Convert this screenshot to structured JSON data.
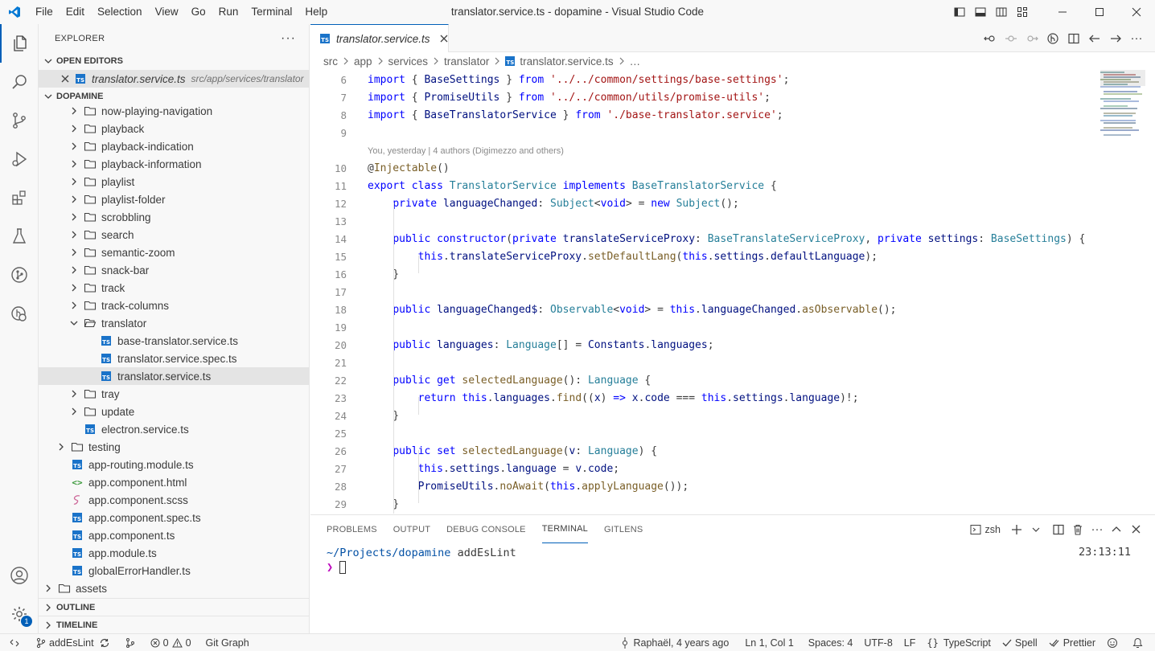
{
  "window": {
    "title": "translator.service.ts - dopamine - Visual Studio Code",
    "menu": [
      "File",
      "Edit",
      "Selection",
      "View",
      "Go",
      "Run",
      "Terminal",
      "Help"
    ]
  },
  "sidebar": {
    "header": "EXPLORER",
    "open_editors_label": "OPEN EDITORS",
    "open_editor": {
      "name": "translator.service.ts",
      "path": "src/app/services/translator"
    },
    "project_label": "DOPAMINE",
    "tree": [
      {
        "label": "now-playing-navigation",
        "type": "folder",
        "depth": 4,
        "open": false
      },
      {
        "label": "playback",
        "type": "folder",
        "depth": 4,
        "open": false
      },
      {
        "label": "playback-indication",
        "type": "folder",
        "depth": 4,
        "open": false
      },
      {
        "label": "playback-information",
        "type": "folder",
        "depth": 4,
        "open": false
      },
      {
        "label": "playlist",
        "type": "folder",
        "depth": 4,
        "open": false
      },
      {
        "label": "playlist-folder",
        "type": "folder",
        "depth": 4,
        "open": false
      },
      {
        "label": "scrobbling",
        "type": "folder",
        "depth": 4,
        "open": false
      },
      {
        "label": "search",
        "type": "folder",
        "depth": 4,
        "open": false
      },
      {
        "label": "semantic-zoom",
        "type": "folder",
        "depth": 4,
        "open": false
      },
      {
        "label": "snack-bar",
        "type": "folder",
        "depth": 4,
        "open": false
      },
      {
        "label": "track",
        "type": "folder",
        "depth": 4,
        "open": false
      },
      {
        "label": "track-columns",
        "type": "folder",
        "depth": 4,
        "open": false
      },
      {
        "label": "translator",
        "type": "folder",
        "depth": 4,
        "open": true
      },
      {
        "label": "base-translator.service.ts",
        "type": "ts",
        "depth": 5
      },
      {
        "label": "translator.service.spec.ts",
        "type": "ts",
        "depth": 5
      },
      {
        "label": "translator.service.ts",
        "type": "ts",
        "depth": 5,
        "selected": true
      },
      {
        "label": "tray",
        "type": "folder",
        "depth": 4,
        "open": false
      },
      {
        "label": "update",
        "type": "folder",
        "depth": 4,
        "open": false
      },
      {
        "label": "electron.service.ts",
        "type": "ts",
        "depth": 4
      },
      {
        "label": "testing",
        "type": "folder",
        "depth": 3,
        "open": false
      },
      {
        "label": "app-routing.module.ts",
        "type": "ts",
        "depth": 3
      },
      {
        "label": "app.component.html",
        "type": "html",
        "depth": 3
      },
      {
        "label": "app.component.scss",
        "type": "scss",
        "depth": 3
      },
      {
        "label": "app.component.spec.ts",
        "type": "ts",
        "depth": 3
      },
      {
        "label": "app.component.ts",
        "type": "ts",
        "depth": 3
      },
      {
        "label": "app.module.ts",
        "type": "ts",
        "depth": 3
      },
      {
        "label": "globalErrorHandler.ts",
        "type": "ts",
        "depth": 3
      },
      {
        "label": "assets",
        "type": "folder",
        "depth": 2,
        "open": false
      }
    ],
    "outline_label": "OUTLINE",
    "timeline_label": "TIMELINE"
  },
  "editor": {
    "tab": "translator.service.ts",
    "breadcrumb": [
      "src",
      "app",
      "services",
      "translator",
      "translator.service.ts",
      "…"
    ],
    "blame": "You, yesterday | 4 authors (Digimezzo and others)",
    "lines": [
      {
        "n": "6",
        "html": "<span class=\"kw\">import</span> { <span class=\"pr\">BaseSettings</span> } <span class=\"kw\">from</span> <span class=\"str\">'../../common/settings/base-settings'</span>;"
      },
      {
        "n": "7",
        "html": "<span class=\"kw\">import</span> { <span class=\"pr\">PromiseUtils</span> } <span class=\"kw\">from</span> <span class=\"str\">'../../common/utils/promise-utils'</span>;"
      },
      {
        "n": "8",
        "html": "<span class=\"kw\">import</span> { <span class=\"pr\">BaseTranslatorService</span> } <span class=\"kw\">from</span> <span class=\"str\">'./base-translator.service'</span>;"
      },
      {
        "n": "9",
        "html": ""
      },
      {
        "n": "",
        "blame": true
      },
      {
        "n": "10",
        "html": "@<span class=\"dec\">Injectable</span>()"
      },
      {
        "n": "11",
        "html": "<span class=\"kw\">export</span> <span class=\"kw\">class</span> <span class=\"ty\">TranslatorService</span> <span class=\"kw\">implements</span> <span class=\"ty\">BaseTranslatorService</span> {"
      },
      {
        "n": "12",
        "html": "    <span class=\"kw\">private</span> <span class=\"pr\">languageChanged</span>: <span class=\"ty\">Subject</span>&lt;<span class=\"kw\">void</span>&gt; = <span class=\"kw\">new</span> <span class=\"ty\">Subject</span>();"
      },
      {
        "n": "13",
        "html": ""
      },
      {
        "n": "14",
        "html": "    <span class=\"kw\">public</span> <span class=\"kw\">constructor</span>(<span class=\"kw\">private</span> <span class=\"pr\">translateServiceProxy</span>: <span class=\"ty\">BaseTranslateServiceProxy</span>, <span class=\"kw\">private</span> <span class=\"pr\">settings</span>: <span class=\"ty\">BaseSettings</span>) {"
      },
      {
        "n": "15",
        "html": "        <span class=\"kw\">this</span>.<span class=\"pr\">translateServiceProxy</span>.<span class=\"fn\">setDefaultLang</span>(<span class=\"kw\">this</span>.<span class=\"pr\">settings</span>.<span class=\"pr\">defaultLanguage</span>);"
      },
      {
        "n": "16",
        "html": "    }"
      },
      {
        "n": "17",
        "html": ""
      },
      {
        "n": "18",
        "html": "    <span class=\"kw\">public</span> <span class=\"pr\">languageChanged$</span>: <span class=\"ty\">Observable</span>&lt;<span class=\"kw\">void</span>&gt; = <span class=\"kw\">this</span>.<span class=\"pr\">languageChanged</span>.<span class=\"fn\">asObservable</span>();"
      },
      {
        "n": "19",
        "html": ""
      },
      {
        "n": "20",
        "html": "    <span class=\"kw\">public</span> <span class=\"pr\">languages</span>: <span class=\"ty\">Language</span>[] = <span class=\"pr\">Constants</span>.<span class=\"pr\">languages</span>;"
      },
      {
        "n": "21",
        "html": ""
      },
      {
        "n": "22",
        "html": "    <span class=\"kw\">public</span> <span class=\"kw\">get</span> <span class=\"fn\">selectedLanguage</span>(): <span class=\"ty\">Language</span> {"
      },
      {
        "n": "23",
        "html": "        <span class=\"kw\">return</span> <span class=\"kw\">this</span>.<span class=\"pr\">languages</span>.<span class=\"fn\">find</span>((<span class=\"pr\">x</span>) <span class=\"kw\">=&gt;</span> <span class=\"pr\">x</span>.<span class=\"pr\">code</span> === <span class=\"kw\">this</span>.<span class=\"pr\">settings</span>.<span class=\"pr\">language</span>)!;"
      },
      {
        "n": "24",
        "html": "    }"
      },
      {
        "n": "25",
        "html": ""
      },
      {
        "n": "26",
        "html": "    <span class=\"kw\">public</span> <span class=\"kw\">set</span> <span class=\"fn\">selectedLanguage</span>(<span class=\"pr\">v</span>: <span class=\"ty\">Language</span>) {"
      },
      {
        "n": "27",
        "html": "        <span class=\"kw\">this</span>.<span class=\"pr\">settings</span>.<span class=\"pr\">language</span> = <span class=\"pr\">v</span>.<span class=\"pr\">code</span>;"
      },
      {
        "n": "28",
        "html": "        <span class=\"pr\">PromiseUtils</span>.<span class=\"fn\">noAwait</span>(<span class=\"kw\">this</span>.<span class=\"fn\">applyLanguage</span>());"
      },
      {
        "n": "29",
        "html": "    }"
      }
    ]
  },
  "panel": {
    "tabs": [
      "PROBLEMS",
      "OUTPUT",
      "DEBUG CONSOLE",
      "TERMINAL",
      "GITLENS"
    ],
    "active_tab": "TERMINAL",
    "shell": "zsh",
    "terminal": {
      "path": "~/Projects/dopamine",
      "branch": "addEsLint",
      "time": "23:13:11",
      "prompt": "❯"
    }
  },
  "statusbar": {
    "branch": "addEsLint",
    "errors": "0",
    "warnings": "0",
    "git_graph": "Git Graph",
    "blame": "Raphaël, 4 years ago",
    "position": "Ln 1, Col 1",
    "spaces": "Spaces: 4",
    "encoding": "UTF-8",
    "eol": "LF",
    "language": "TypeScript",
    "spell": "Spell",
    "prettier": "Prettier"
  },
  "accounts_badge": "1",
  "colors": {
    "accent": "#005fb8",
    "ts_icon": "#1a73c9",
    "keyword": "#0000ff",
    "type": "#267f99",
    "string": "#a31515",
    "function": "#795e26"
  }
}
